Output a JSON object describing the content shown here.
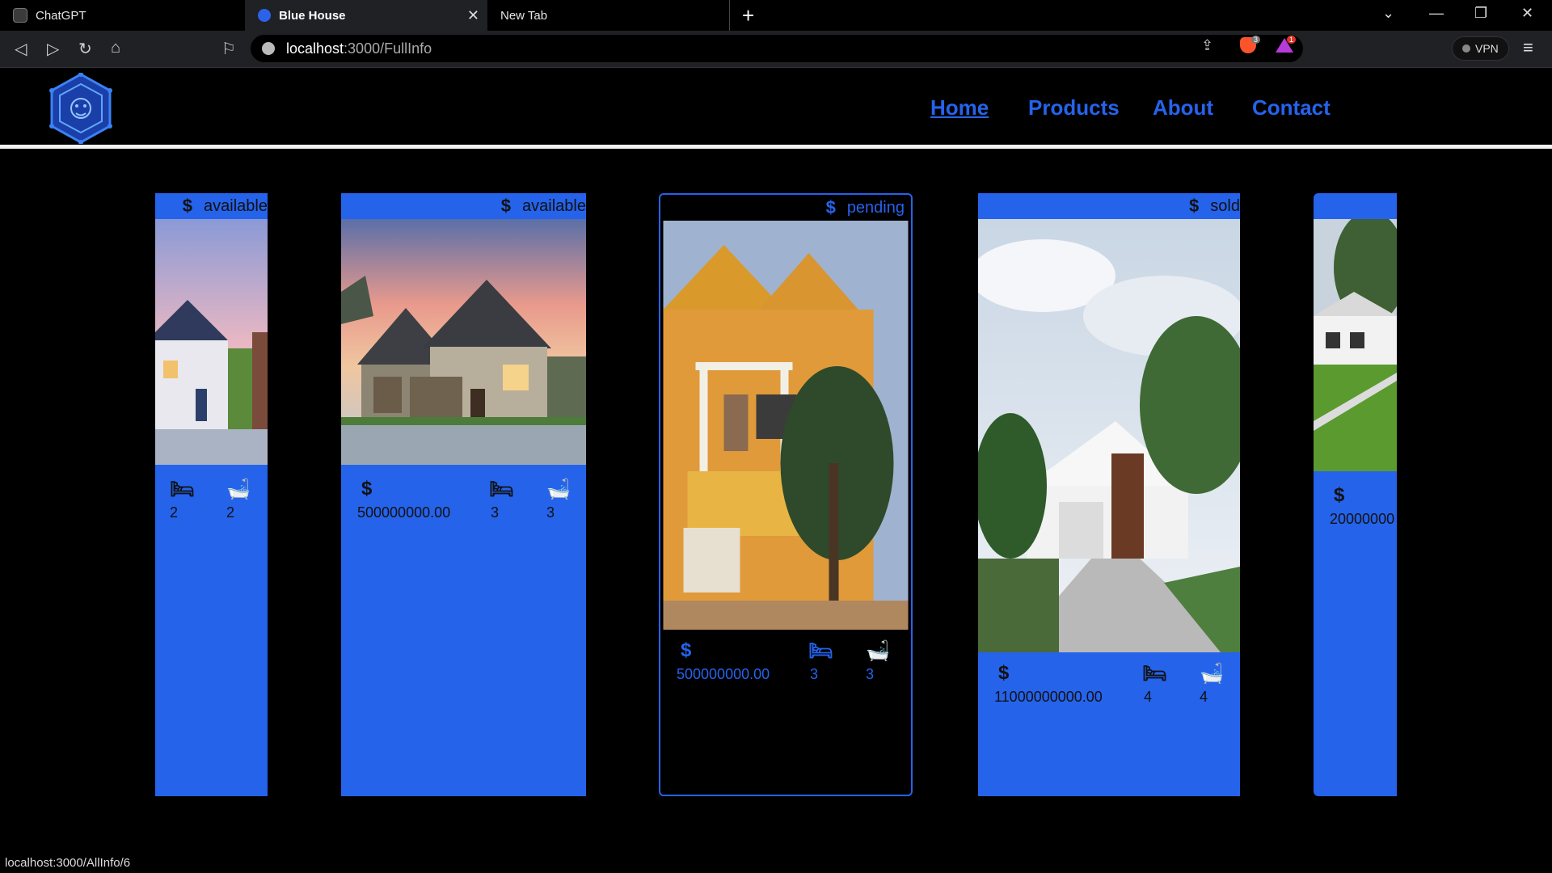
{
  "browser": {
    "tabs": [
      {
        "title": "ChatGPT"
      },
      {
        "title": "Blue House"
      },
      {
        "title": "New Tab"
      }
    ],
    "url_host": "localhost",
    "url_path": ":3000/FullInfo",
    "shield_count": "3",
    "rewards_count": "1",
    "vpn_label": "VPN",
    "status_url": "localhost:3000/AllInfo/6"
  },
  "nav": {
    "items": [
      "Home",
      "Products",
      "About",
      "Contact"
    ],
    "active": "Home",
    "accent": "#2563eb"
  },
  "cards": [
    {
      "status": "available",
      "price": "",
      "beds": "2",
      "baths": "2"
    },
    {
      "status": "available",
      "price": "500000000.00",
      "beds": "3",
      "baths": "3"
    },
    {
      "status": "pending",
      "price": "500000000.00",
      "beds": "3",
      "baths": "3"
    },
    {
      "status": "sold",
      "price": "11000000000.00",
      "beds": "4",
      "baths": "4"
    },
    {
      "status": "",
      "price": "20000000",
      "beds": "",
      "baths": ""
    }
  ],
  "icons": {
    "price": "dollar-icon",
    "beds": "bed-icon",
    "baths": "bathtub-icon"
  }
}
